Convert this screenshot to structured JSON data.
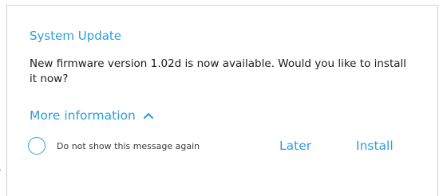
{
  "dialog": {
    "title": "System Update",
    "message": "New firmware version 1.02d is now available. Would you like to install it now?",
    "more_info_label": "More information",
    "more_info_icon": "chevron-up-icon",
    "do_not_show_label": "Do not show this message again",
    "do_not_show_checked": false,
    "later_label": "Later",
    "install_label": "Install"
  },
  "colors": {
    "accent": "#2d9fd8",
    "text": "#1c1c1c",
    "border": "#d0d0d0"
  }
}
